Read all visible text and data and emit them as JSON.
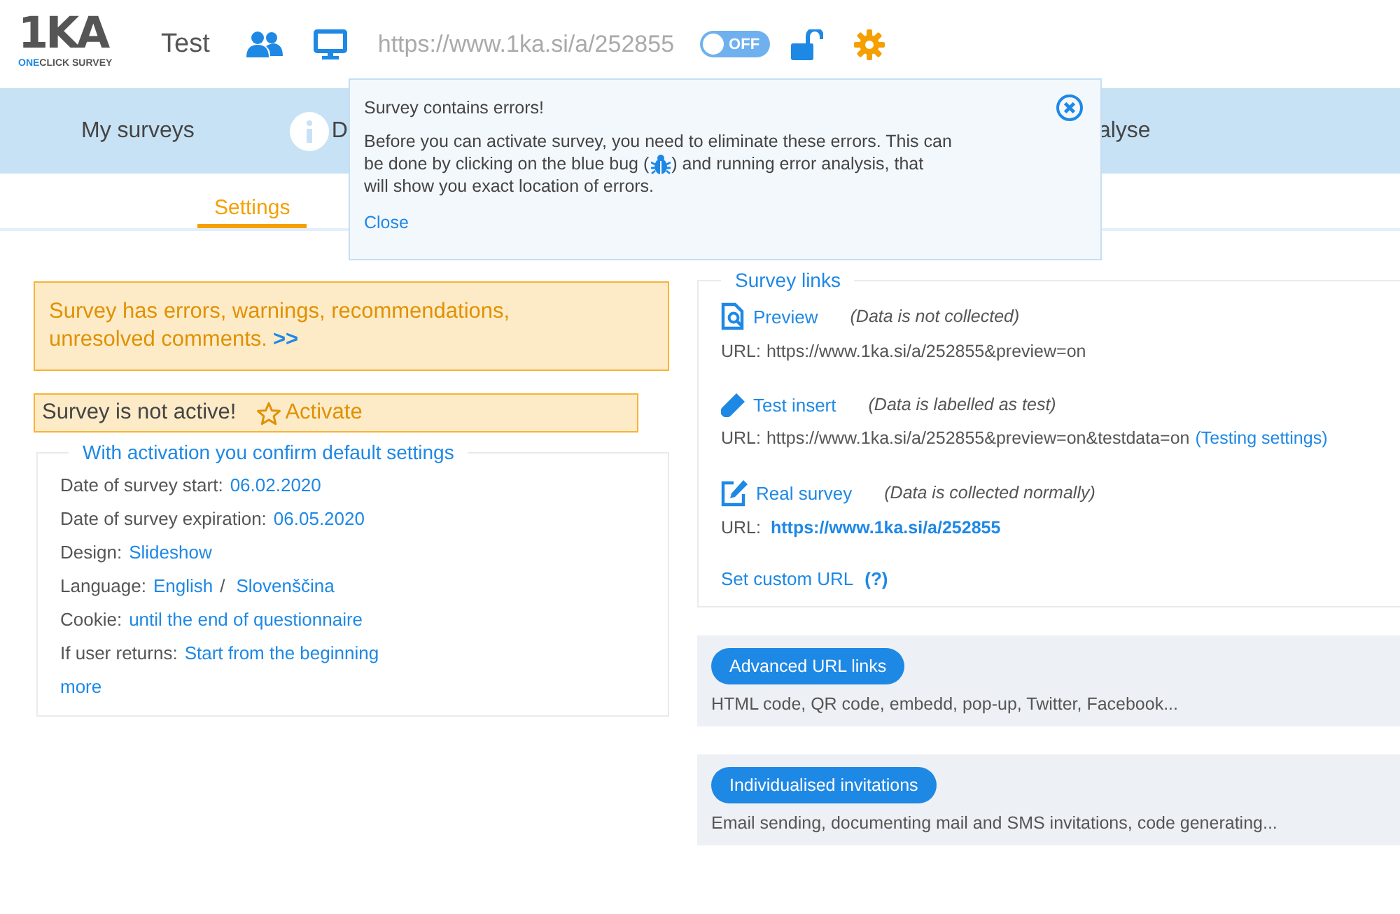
{
  "header": {
    "logo": "1KA",
    "tagline_a": "ONE",
    "tagline_b": "CLICK SURVEY",
    "survey_name": "Test",
    "url": "https://www.1ka.si/a/252855",
    "toggle": {
      "label": "OFF",
      "on": false
    }
  },
  "nav": [
    "My surveys",
    "D",
    "alyse"
  ],
  "subtabs": [
    {
      "label": "Settings",
      "selected": true
    }
  ],
  "popup": {
    "title": "Survey contains errors!",
    "line1": "Before you can activate survey, you need to eliminate these errors. This can",
    "line2_before": "be done by clicking on the blue bug (",
    "line2_after": ") and running error analysis, that",
    "line3": "will show you exact location of errors.",
    "close": "Close"
  },
  "errors_alert": {
    "line1": "Survey has errors, warnings, recommendations,",
    "line2": "unresolved comments.",
    "link": ">>"
  },
  "activation": {
    "status": "Survey is not active!",
    "button": "Activate"
  },
  "defaults": {
    "legend": "With activation you confirm default settings",
    "rows": [
      {
        "label": "Date of survey start:",
        "values": [
          "06.02.2020"
        ]
      },
      {
        "label": "Date of survey expiration:",
        "values": [
          "06.05.2020"
        ]
      },
      {
        "label": "Design:",
        "values": [
          "Slideshow"
        ]
      },
      {
        "label": "Language:",
        "values": [
          "English",
          "Slovenščina"
        ],
        "separator": "/"
      },
      {
        "label": "Cookie:",
        "values": [
          "until the end of questionnaire"
        ]
      },
      {
        "label": "If user returns:",
        "values": [
          "Start from the beginning"
        ]
      }
    ],
    "more": "more"
  },
  "links": {
    "legend": "Survey links",
    "items": [
      {
        "kind": "preview",
        "title": "Preview",
        "note": "(Data is not collected)",
        "url_label": "URL:",
        "url": "https://www.1ka.si/a/252855&preview=on",
        "url_bold": false
      },
      {
        "kind": "test",
        "title": "Test insert",
        "note": "(Data is labelled as test)",
        "url_label": "URL:",
        "url": "https://www.1ka.si/a/252855&preview=on&testdata=on",
        "url_bold": false,
        "settings_link": "(Testing settings)"
      },
      {
        "kind": "real",
        "title": "Real survey",
        "note": "(Data is collected normally)",
        "url_label": "URL:",
        "url": "https://www.1ka.si/a/252855",
        "url_bold": true
      }
    ],
    "custom": "Set custom URL",
    "help": "(?)"
  },
  "cards": [
    {
      "button": "Advanced URL links",
      "description": "HTML code, QR code, embedd, pop-up, Twitter, Facebook..."
    },
    {
      "button": "Individualised invitations",
      "description": "Email sending, documenting mail and SMS invitations, code generating..."
    }
  ]
}
